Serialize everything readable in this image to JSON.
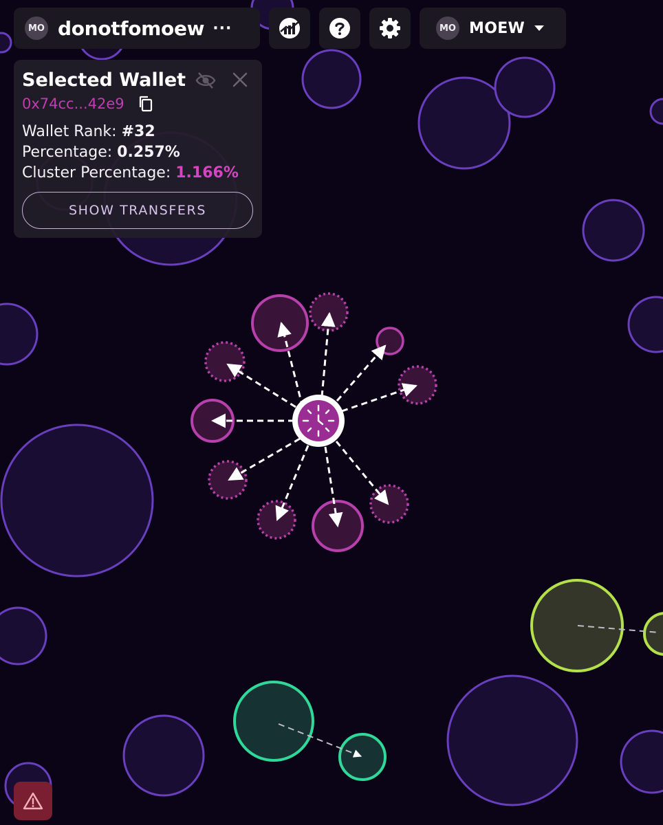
{
  "header": {
    "token_avatar": "MO",
    "token_name": "donotfomoew",
    "more_glyph": "···",
    "account_avatar": "MO",
    "account_name": "MOEW",
    "icons": [
      "stats-chart-icon",
      "help-icon",
      "gear-icon",
      "chevron-down-icon"
    ]
  },
  "wallet_panel": {
    "title": "Selected Wallet",
    "address": "0x74cc...42e9",
    "rank_label": "Wallet Rank: ",
    "rank_value": "#32",
    "percentage_label": "Percentage: ",
    "percentage_value": "0.257%",
    "cluster_label": "Cluster Percentage: ",
    "cluster_value": "1.166%",
    "show_transfers_label": "SHOW TRANSFERS",
    "icons": [
      "eye-off-icon",
      "close-icon",
      "copy-icon"
    ]
  },
  "alert": {
    "icon": "warning-icon"
  },
  "colors": {
    "background": "#0a0416",
    "purple_bubble": "#6a3fbf",
    "magenta_bubble": "#a43aa0",
    "magenta_text": "#c33bb1",
    "green_bubble": "#30d89a",
    "lime_bubble": "#b4e04c",
    "alert": "#7a1f32"
  }
}
